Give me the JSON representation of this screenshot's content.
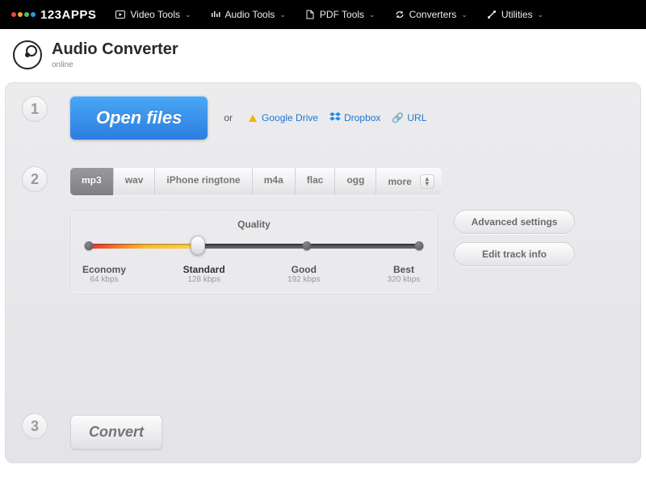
{
  "brand": {
    "text": "123APPS",
    "dotColors": [
      "#e54b4b",
      "#f5a623",
      "#4cc26b",
      "#2d9cdb"
    ]
  },
  "nav": {
    "items": [
      {
        "label": "Video Tools"
      },
      {
        "label": "Audio Tools"
      },
      {
        "label": "PDF Tools"
      },
      {
        "label": "Converters"
      },
      {
        "label": "Utilities"
      }
    ]
  },
  "page": {
    "title": "Audio Converter",
    "subtitle": "online"
  },
  "steps": {
    "one": "1",
    "two": "2",
    "three": "3"
  },
  "step1": {
    "open": "Open files",
    "or": "or",
    "sources": {
      "gdrive": "Google Drive",
      "dropbox": "Dropbox",
      "url": "URL"
    }
  },
  "step2": {
    "formats": [
      "mp3",
      "wav",
      "iPhone ringtone",
      "m4a",
      "flac",
      "ogg",
      "more"
    ],
    "activeFormatIndex": 0,
    "quality": {
      "title": "Quality",
      "levels": [
        {
          "name": "Economy",
          "bitrate": "64 kbps"
        },
        {
          "name": "Standard",
          "bitrate": "128 kbps"
        },
        {
          "name": "Good",
          "bitrate": "192 kbps"
        },
        {
          "name": "Best",
          "bitrate": "320 kbps"
        }
      ],
      "selectedIndex": 1
    },
    "advanced": "Advanced settings",
    "editTrack": "Edit track info"
  },
  "step3": {
    "convert": "Convert"
  }
}
